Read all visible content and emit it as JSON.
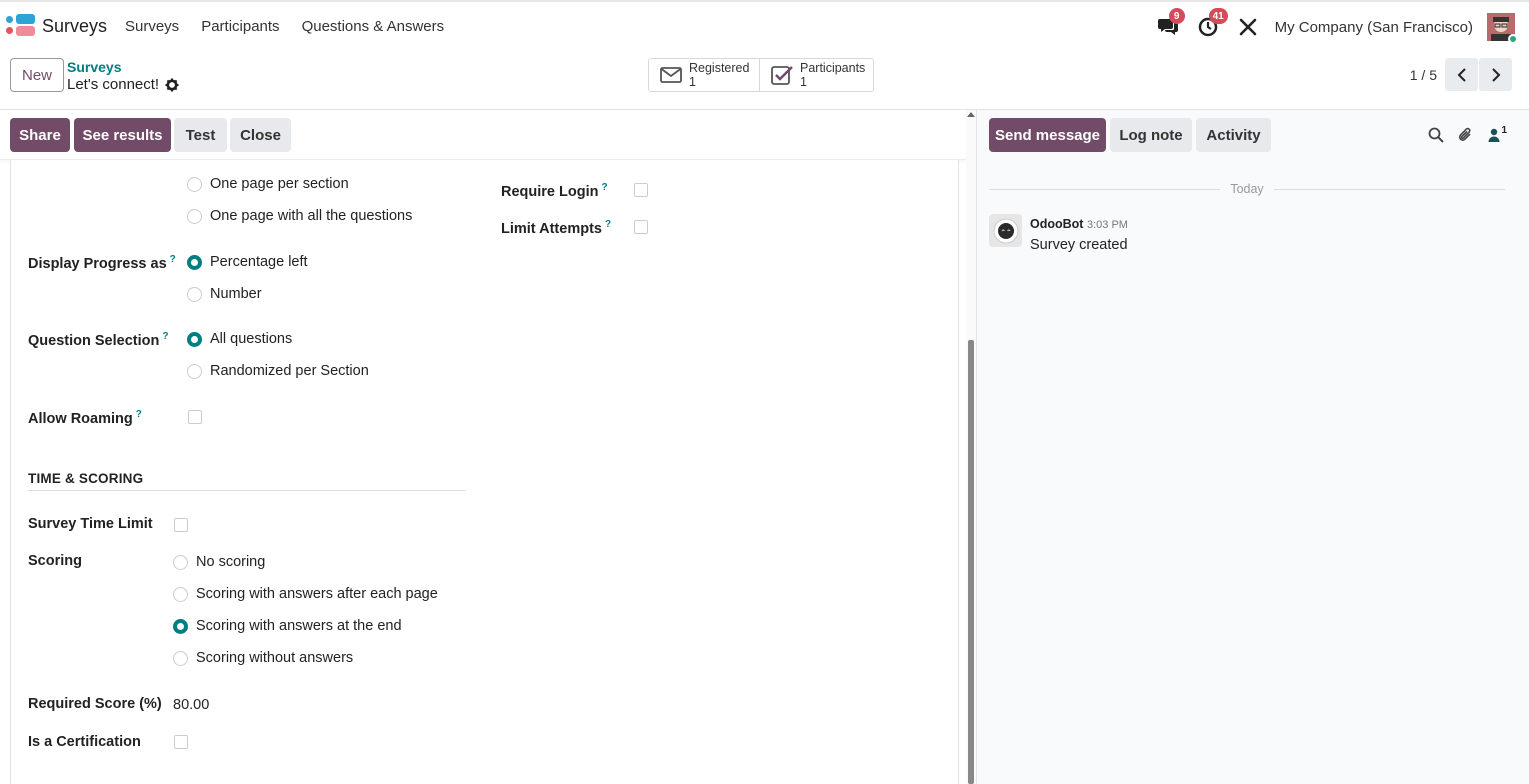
{
  "navbar": {
    "app_name": "Surveys",
    "menu": [
      "Surveys",
      "Participants",
      "Questions & Answers"
    ],
    "messages_count": "9",
    "activities_count": "41",
    "company": "My Company (San Francisco)"
  },
  "control": {
    "new_label": "New",
    "breadcrumb": "Surveys",
    "record_name": "Let's connect!",
    "registered_label": "Registered",
    "registered_value": "1",
    "participants_label": "Participants",
    "participants_value": "1",
    "pager": "1 / 5"
  },
  "statusbar": {
    "share": "Share",
    "see_results": "See results",
    "test": "Test",
    "close": "Close"
  },
  "form": {
    "layout_options": [
      "One page per section",
      "One page with all the questions"
    ],
    "display_progress": {
      "label": "Display Progress as",
      "help": "?",
      "options": [
        "Percentage left",
        "Number"
      ],
      "selected": 0
    },
    "question_selection": {
      "label": "Question Selection",
      "help": "?",
      "options": [
        "All questions",
        "Randomized per Section"
      ],
      "selected": 0
    },
    "allow_roaming": {
      "label": "Allow Roaming",
      "help": "?",
      "checked": false
    },
    "require_login": {
      "label": "Require Login",
      "help": "?",
      "checked": false
    },
    "limit_attempts": {
      "label": "Limit Attempts",
      "help": "?",
      "checked": false
    },
    "time_scoring_title": "TIME & SCORING",
    "survey_time_limit": {
      "label": "Survey Time Limit",
      "checked": false
    },
    "scoring": {
      "label": "Scoring",
      "options": [
        "No scoring",
        "Scoring with answers after each page",
        "Scoring with answers at the end",
        "Scoring without answers"
      ],
      "selected": 2
    },
    "required_score": {
      "label": "Required Score (%)",
      "value": "80.00"
    },
    "is_certification": {
      "label": "Is a Certification",
      "checked": false
    }
  },
  "chatter": {
    "send_message": "Send message",
    "log_note": "Log note",
    "activity": "Activity",
    "followers_count": "1",
    "today_label": "Today",
    "message": {
      "author": "OdooBot",
      "time": "3:03 PM",
      "body": "Survey created"
    }
  },
  "colors": {
    "primary": "#714b67",
    "accent": "#017e84",
    "badge": "#d44c59"
  }
}
